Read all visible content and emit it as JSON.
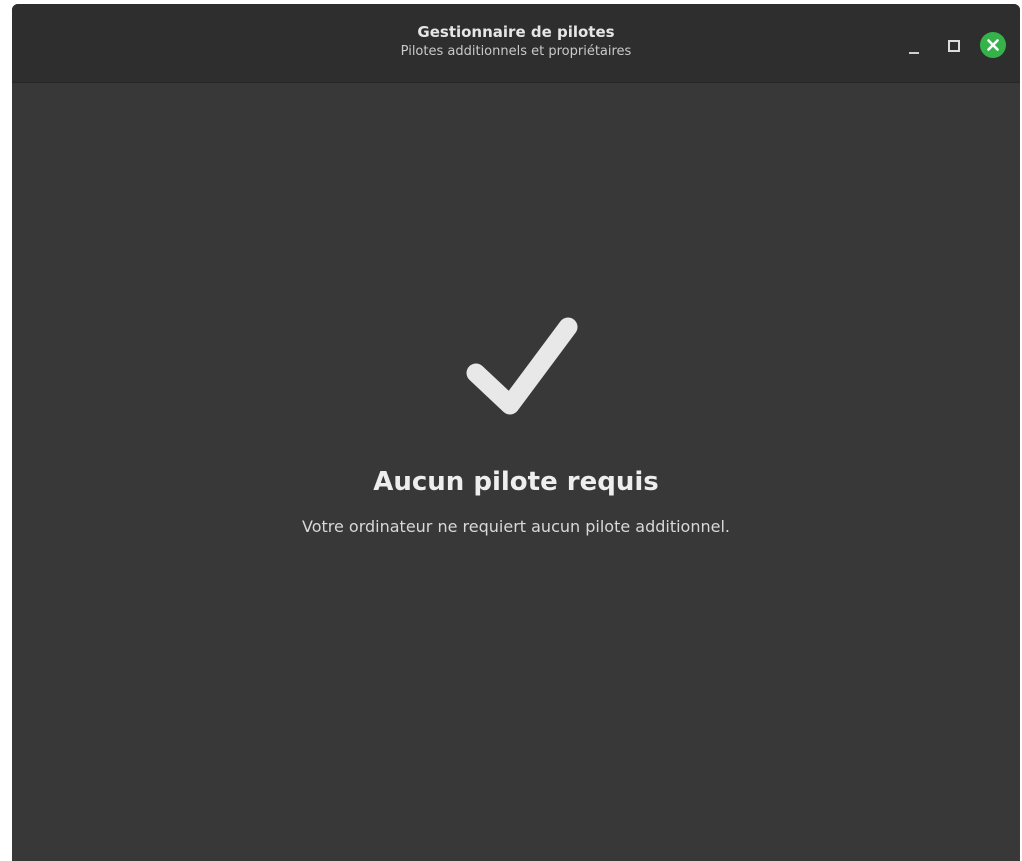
{
  "window": {
    "title": "Gestionnaire de pilotes",
    "subtitle": "Pilotes additionnels et propriétaires"
  },
  "controls": {
    "minimize_icon": "minimize-icon",
    "maximize_icon": "maximize-icon",
    "close_icon": "close-icon",
    "close_color": "#35b34a"
  },
  "status": {
    "icon": "checkmark-icon",
    "title": "Aucun pilote requis",
    "message": "Votre ordinateur ne requiert aucun pilote additionnel."
  },
  "colors": {
    "background": "#383838",
    "header": "#2e2e2e",
    "text": "#eeeeee"
  }
}
